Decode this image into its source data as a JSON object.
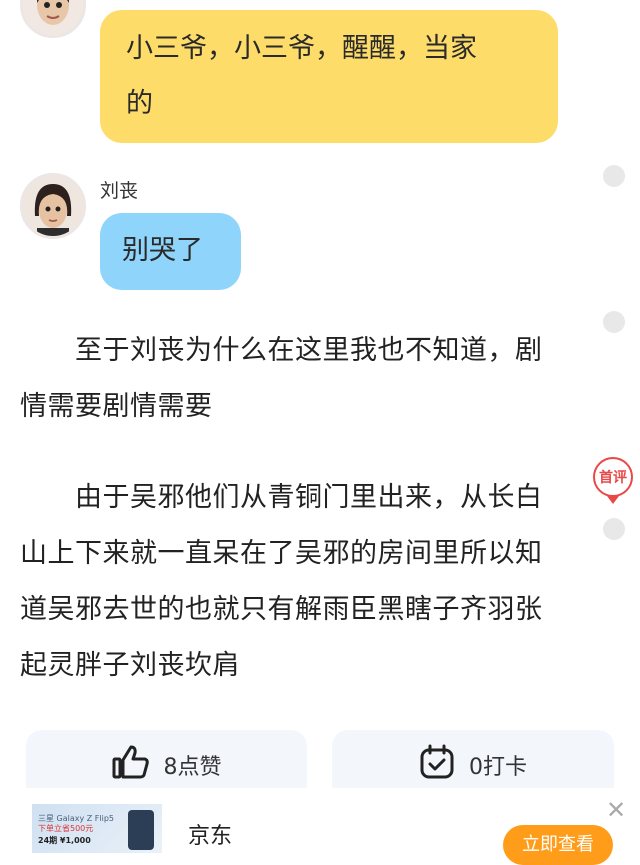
{
  "messages": [
    {
      "sender": "",
      "text": "小三爷，小三爷，醒醒，当家的",
      "line1": "小三爷，小三爷，醒醒，当家",
      "line2": "的"
    },
    {
      "sender": "刘丧",
      "text": "别哭了"
    }
  ],
  "paragraphs": [
    {
      "lines": [
        "　　至于刘丧为什么在这里我也不知道，剧",
        "情需要剧情需要"
      ]
    },
    {
      "lines": [
        "　　由于吴邪他们从青铜门里出来，从长白",
        "山上下来就一直呆在了吴邪的房间里所以知",
        "道吴邪去世的也就只有解雨臣黑瞎子齐羽张",
        "起灵胖子刘丧坎肩"
      ]
    }
  ],
  "badge": {
    "label": "首评"
  },
  "actions": {
    "like": {
      "count_label": "8点赞",
      "icon": "thumbs-up-icon"
    },
    "checkin": {
      "count_label": "0打卡",
      "icon": "calendar-check-icon"
    }
  },
  "ad": {
    "brand": "京东",
    "cta": "立即查看",
    "image_text_1": "三星 Galaxy Z Flip5",
    "image_text_2": "下单立省500元",
    "image_text_3": "24期 ¥1,000",
    "close_icon": "close-icon"
  },
  "colors": {
    "yellow_bubble": "#fddc6a",
    "blue_bubble": "#8fd4fa",
    "accent_red": "#e94848",
    "cta_orange": "#ff9c1a"
  }
}
